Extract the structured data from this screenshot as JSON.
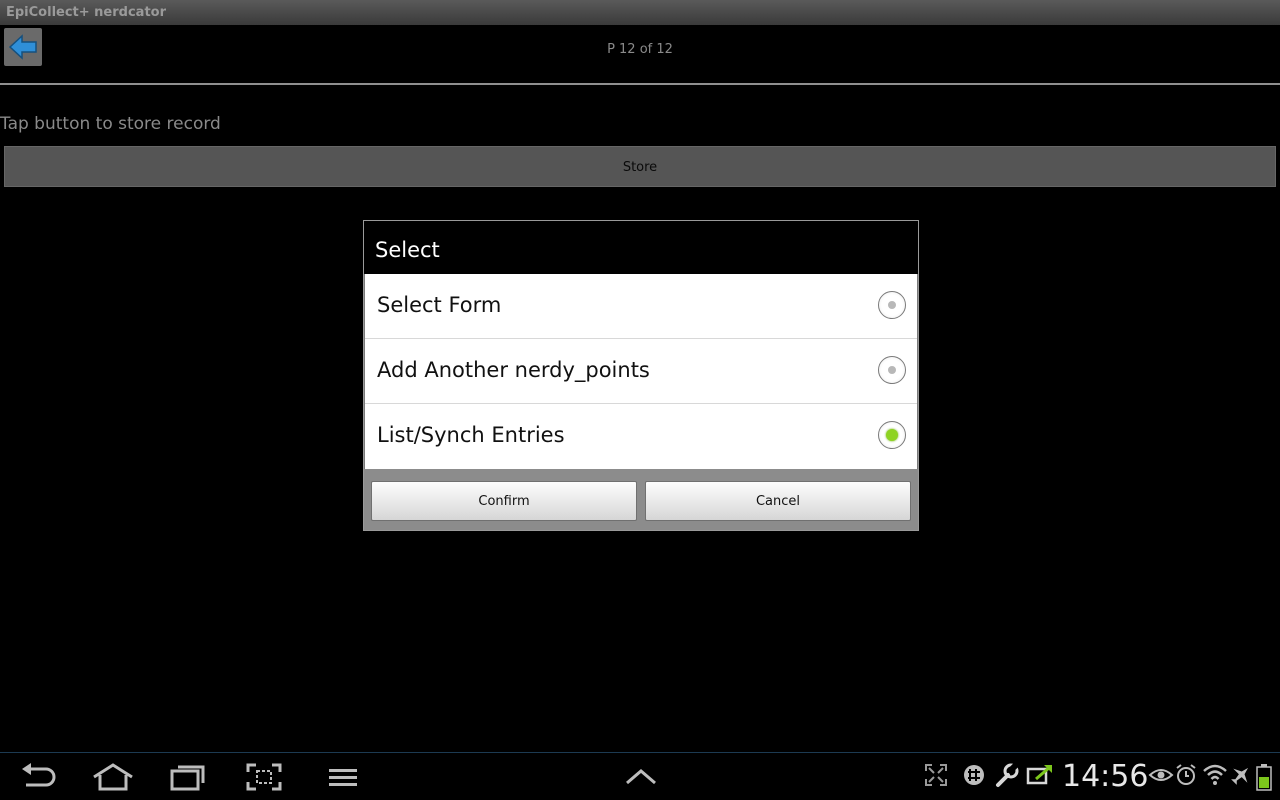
{
  "app": {
    "title": "EpiCollect+ nerdcator"
  },
  "header": {
    "page_indicator": "P 12 of 12"
  },
  "content": {
    "hint": "Tap button to store record",
    "store_label": "Store"
  },
  "dialog": {
    "title": "Select",
    "options": [
      {
        "label": "Select Form",
        "checked": false
      },
      {
        "label": "Add Another nerdy_points",
        "checked": false
      },
      {
        "label": "List/Synch Entries",
        "checked": true
      }
    ],
    "confirm_label": "Confirm",
    "cancel_label": "Cancel"
  },
  "system_bar": {
    "time": "14:56",
    "left_icons": [
      "back-icon",
      "home-icon",
      "recent-apps-icon",
      "screenshot-icon",
      "menu-icon"
    ],
    "center_icon": "chevron-up-icon",
    "right_icons": [
      "fullscreen-icon",
      "settings-app-icon",
      "wrench-icon",
      "sync-icon",
      "eye-icon",
      "alarm-icon",
      "wifi-icon",
      "airplane-icon",
      "battery-icon"
    ],
    "colors": {
      "accent_green": "#8ed322",
      "battery_green": "#7cc61c",
      "sync_green": "#7cc61c"
    }
  }
}
